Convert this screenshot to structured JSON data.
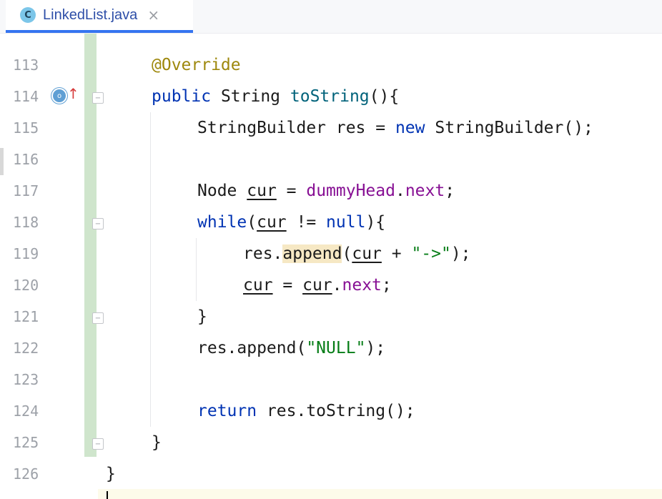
{
  "tab": {
    "icon_letter": "C",
    "icon_name": "class-icon",
    "file_name": "LinkedList.java",
    "close_glyph": "×"
  },
  "gutter": {
    "line_numbers": [
      "113",
      "114",
      "115",
      "116",
      "117",
      "118",
      "119",
      "120",
      "121",
      "122",
      "123",
      "124",
      "125",
      "126"
    ]
  },
  "code": {
    "l113": {
      "a": "@Override"
    },
    "l114": {
      "kw": "public",
      "t1": " String ",
      "fn": "toString",
      "t2": "(){"
    },
    "l115": {
      "t1": "StringBuilder res = ",
      "kw": "new",
      "t2": " StringBuilder();"
    },
    "l117": {
      "t1": "Node ",
      "v": "cur",
      "t2": " = ",
      "f1": "dummyHead",
      "t3": ".",
      "f2": "next",
      "t4": ";"
    },
    "l118": {
      "kw": "while",
      "t1": "(",
      "v": "cur",
      "t2": " != ",
      "kw2": "null",
      "t3": "){"
    },
    "l119": {
      "t1": "res.",
      "hl": "append",
      "t2": "(",
      "v": "cur",
      "t3": " + ",
      "s": "\"->\"",
      "t4": ");"
    },
    "l120": {
      "v1": "cur",
      "t1": " = ",
      "v2": "cur",
      "t2": ".",
      "f": "next",
      "t3": ";"
    },
    "l121": {
      "t": "}"
    },
    "l122": {
      "t1": "res.append(",
      "s": "\"NULL\"",
      "t2": ");"
    },
    "l124": {
      "kw": "return",
      "t1": " res.toString();"
    },
    "l125": {
      "t": "}"
    },
    "l126": {
      "t": "}"
    }
  },
  "colors": {
    "keyword": "#0033b3",
    "annotation": "#9e880d",
    "method": "#00627a",
    "field": "#871094",
    "string": "#067d17",
    "tab_accent": "#3574f0",
    "vcs_changed": "#cfe5cc"
  }
}
